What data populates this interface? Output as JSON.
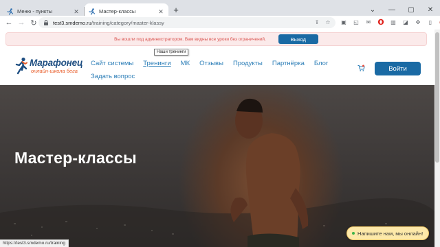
{
  "browser": {
    "tabs": [
      {
        "title": "Меню - пункты",
        "active": false
      },
      {
        "title": "Мастер-классы",
        "active": true
      }
    ],
    "new_tab_symbol": "+",
    "url_host": "test3.smdemo.ru",
    "url_path": "/training/category/master-klassy",
    "status_url": "https://test3.smdemo.ru/training"
  },
  "admin_bar": {
    "message": "Вы вошли под администратором. Вам видны все уроки без ограничений.",
    "logout_label": "Выход"
  },
  "logo": {
    "name": "Марафонец",
    "subtitle": "онлайн-школа бега"
  },
  "nav": {
    "row1": [
      "Сайт системы",
      "Тренинги",
      "МК",
      "Отзывы",
      "Продукты",
      "Партнёрка",
      "Блог"
    ],
    "row2": [
      "Задать вопрос"
    ],
    "tooltip": "Наши тренинги"
  },
  "header": {
    "login_label": "Войти"
  },
  "hero": {
    "title": "Мастер-классы"
  },
  "chat": {
    "label": "Напишите нам, мы онлайн!"
  },
  "colors": {
    "brand_blue": "#1a6aa4",
    "link_blue": "#2e7fb8",
    "logo_orange": "#e85d2a",
    "admin_text_red": "#d9534f"
  },
  "icons": {
    "tab_favicon": "runner-icon",
    "cart": "cart-icon",
    "lock": "lock-icon"
  }
}
